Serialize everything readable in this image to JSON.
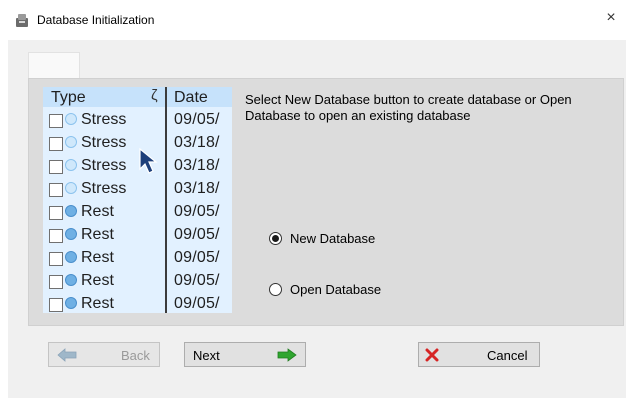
{
  "window": {
    "title": "Database Initialization",
    "close_glyph": "×",
    "icon": "database-app-icon"
  },
  "preview": {
    "col_type": "Type",
    "col_date": "Date",
    "sort_glyph": "ζ",
    "rows": [
      {
        "type": "Stress",
        "date": "09/05/",
        "kind": "stress"
      },
      {
        "type": "Stress",
        "date": "03/18/",
        "kind": "stress"
      },
      {
        "type": "Stress",
        "date": "03/18/",
        "kind": "stress"
      },
      {
        "type": "Stress",
        "date": "03/18/",
        "kind": "stress"
      },
      {
        "type": "Rest",
        "date": "09/05/",
        "kind": "rest"
      },
      {
        "type": "Rest",
        "date": "09/05/",
        "kind": "rest"
      },
      {
        "type": "Rest",
        "date": "09/05/",
        "kind": "rest"
      },
      {
        "type": "Rest",
        "date": "09/05/",
        "kind": "rest"
      },
      {
        "type": "Rest",
        "date": "09/05/",
        "kind": "rest"
      }
    ]
  },
  "instructions": "Select New Database button to create database or Open Database to open an existing database",
  "options": {
    "new_database": "New Database",
    "open_database": "Open Database",
    "selected": "new_database"
  },
  "buttons": {
    "back": "Back",
    "next": "Next",
    "cancel": "Cancel"
  },
  "colors": {
    "next_arrow": "#2fa52f",
    "cancel_x": "#d62424",
    "back_arrow": "#9fb7c9"
  }
}
